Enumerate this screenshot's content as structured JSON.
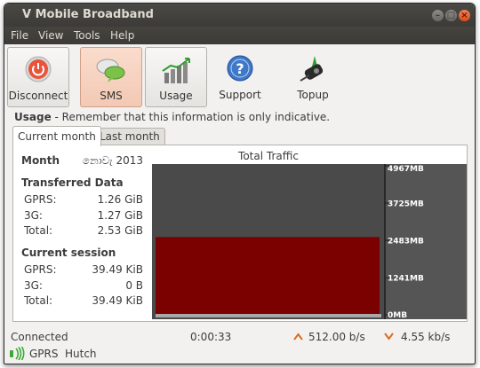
{
  "window": {
    "title": "V Mobile Broadband"
  },
  "menu": [
    "File",
    "View",
    "Tools",
    "Help"
  ],
  "toolbar": {
    "disconnect": "Disconnect",
    "sms": "SMS",
    "usage": "Usage",
    "support": "Support",
    "topup": "Topup"
  },
  "usage_note": {
    "label": "Usage",
    "text": " - Remember that this information is only indicative."
  },
  "tabs": {
    "current": "Current month",
    "last": "Last month"
  },
  "stats": {
    "month_label": "Month",
    "month_value": "නොවැ 2013",
    "transferred_header": "Transferred Data",
    "transferred": [
      {
        "label": "GPRS:",
        "value": "1.26 GiB"
      },
      {
        "label": "3G:",
        "value": "1.27 GiB"
      },
      {
        "label": "Total:",
        "value": "2.53 GiB"
      }
    ],
    "session_header": "Current session",
    "session": [
      {
        "label": "GPRS:",
        "value": "39.49 KiB"
      },
      {
        "label": "3G:",
        "value": "0 B"
      },
      {
        "label": "Total:",
        "value": "39.49 KiB"
      }
    ]
  },
  "chart_data": {
    "type": "bar",
    "title": "Total Traffic",
    "ylim": [
      0,
      4967
    ],
    "yticks": [
      {
        "value": 0,
        "label": "0MB"
      },
      {
        "value": 1241,
        "label": "1241MB"
      },
      {
        "value": 2483,
        "label": "2483MB"
      },
      {
        "value": 3725,
        "label": "3725MB"
      },
      {
        "value": 4967,
        "label": "4967MB"
      }
    ],
    "series": [
      {
        "values": [
          2590
        ]
      }
    ],
    "colors": {
      "bar": "#7b0000",
      "background": "#4a4a4a",
      "baseline": "#a8a8a8",
      "axis": "#555555"
    }
  },
  "status": {
    "connection": "Connected",
    "time": "0:00:33",
    "upload": "512.00 b/s",
    "download": "4.55 kb/s"
  },
  "network": {
    "tech": "GPRS",
    "operator": "Hutch"
  },
  "colors": {
    "accent": "#df4b15",
    "arrow": "#e06a1b",
    "signal": "#3aaa35"
  }
}
